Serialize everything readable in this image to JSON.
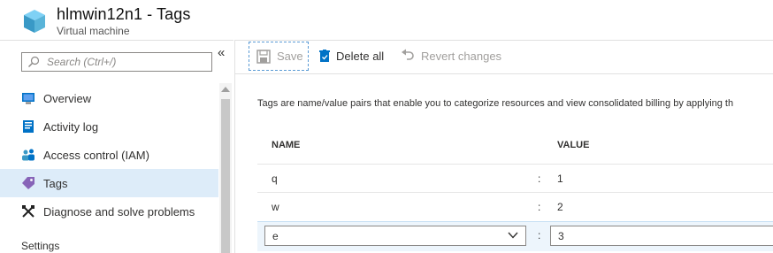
{
  "header": {
    "title": "hlmwin12n1 - Tags",
    "subtitle": "Virtual machine"
  },
  "sidebar": {
    "search_placeholder": "Search (Ctrl+/)",
    "collapse_glyph": "«",
    "items": [
      {
        "label": "Overview",
        "icon": "monitor-icon"
      },
      {
        "label": "Activity log",
        "icon": "log-icon"
      },
      {
        "label": "Access control (IAM)",
        "icon": "people-icon"
      },
      {
        "label": "Tags",
        "icon": "tag-icon",
        "selected": true
      },
      {
        "label": "Diagnose and solve problems",
        "icon": "wrench-icon"
      }
    ],
    "section_label": "Settings"
  },
  "toolbar": {
    "save_label": "Save",
    "delete_all_label": "Delete all",
    "revert_label": "Revert changes"
  },
  "main": {
    "description": "Tags are name/value pairs that enable you to categorize resources and view consolidated billing by applying th",
    "columns": {
      "name": "NAME",
      "value": "VALUE"
    },
    "separator": ":",
    "rows": [
      {
        "name": "q",
        "value": "1"
      },
      {
        "name": "w",
        "value": "2"
      }
    ],
    "edit_row": {
      "name": "e",
      "value": "3"
    }
  },
  "colors": {
    "selected_nav": "#ddecf9",
    "accent": "#0078d4",
    "tag_purple": "#8764b8",
    "edit_row_bg": "#edf5fc"
  }
}
